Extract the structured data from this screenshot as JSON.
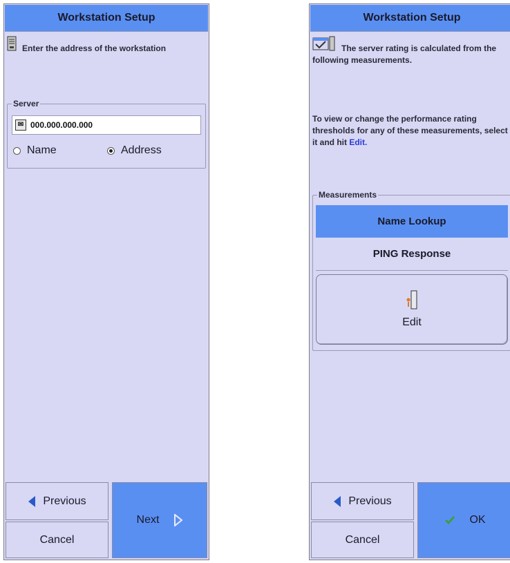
{
  "left_panel": {
    "title": "Workstation Setup",
    "intro_text": "Enter the address of the workstation",
    "server_group": {
      "legend": "Server",
      "address_value": "000.000.000.000",
      "radio_name_label": "Name",
      "radio_address_label": "Address",
      "selected": "Address"
    },
    "buttons": {
      "previous": "Previous",
      "cancel": "Cancel",
      "next": "Next"
    }
  },
  "right_panel": {
    "title": "Workstation Setup",
    "intro_text": "The server rating is calculated from the following measurements.",
    "info_text_before": "To view or change the performance rating thresholds for any of these measurements, select it and hit ",
    "info_link": "Edit.",
    "measurements": {
      "legend": "Measurements",
      "items": [
        "Name Lookup",
        "PING Response"
      ],
      "selected_index": 0
    },
    "buttons": {
      "edit": "Edit",
      "previous": "Previous",
      "cancel": "Cancel",
      "ok": "OK"
    }
  },
  "colors": {
    "panel_bg": "#d8d8f4",
    "accent_blue": "#5a8ff2",
    "link_blue": "#2a3ad8",
    "check_green": "#3aa040",
    "arrow_blue": "#2a5ac8"
  }
}
